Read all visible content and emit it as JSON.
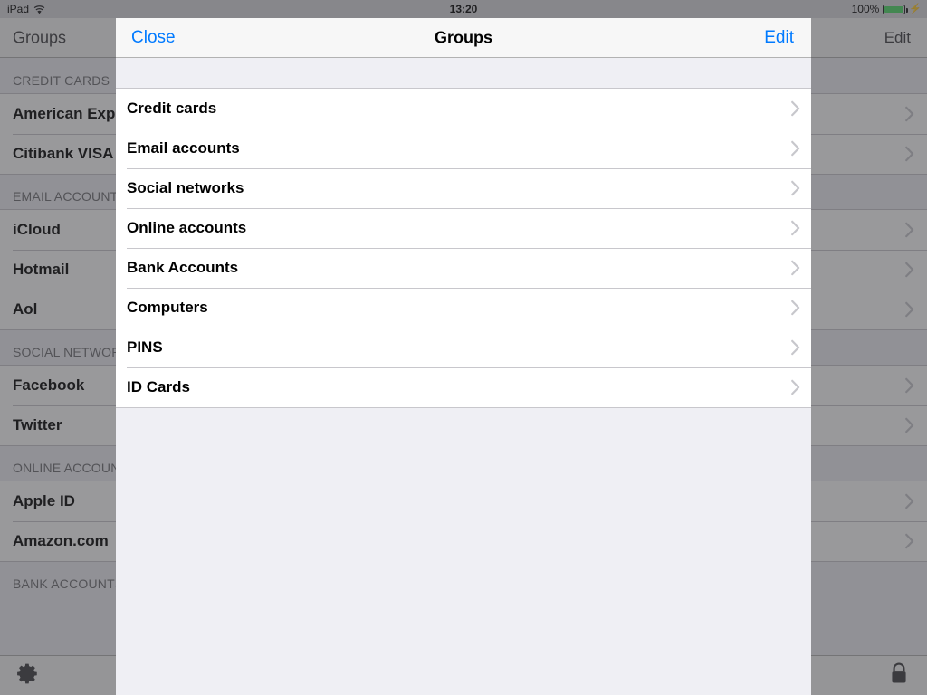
{
  "status_bar": {
    "device": "iPad",
    "wifi_icon": "wifi-icon",
    "time": "13:20",
    "battery_percent": "100%",
    "battery_icon": "battery-icon",
    "charging_icon": "lightning-bolt-icon"
  },
  "background": {
    "nav": {
      "title": "Groups",
      "edit_label": "Edit"
    },
    "sections": [
      {
        "header": "CREDIT CARDS",
        "rows": [
          "American Express",
          "Citibank VISA"
        ]
      },
      {
        "header": "EMAIL ACCOUNTS",
        "rows": [
          "iCloud",
          "Hotmail",
          "Aol"
        ]
      },
      {
        "header": "SOCIAL NETWORKS",
        "rows": [
          "Facebook",
          "Twitter"
        ]
      },
      {
        "header": "ONLINE ACCOUNTS",
        "rows": [
          "Apple ID",
          "Amazon.com"
        ]
      },
      {
        "header": "BANK ACCOUNTS",
        "rows": []
      }
    ],
    "toolbar": {
      "settings_icon": "gear-icon",
      "lock_icon": "lock-icon"
    }
  },
  "modal": {
    "close_label": "Close",
    "title": "Groups",
    "edit_label": "Edit",
    "rows": [
      {
        "label": "Credit cards",
        "accessory": "chevron-right-icon"
      },
      {
        "label": "Email accounts",
        "accessory": "chevron-right-icon"
      },
      {
        "label": "Social networks",
        "accessory": "chevron-right-icon"
      },
      {
        "label": "Online accounts",
        "accessory": "chevron-right-icon"
      },
      {
        "label": "Bank Accounts",
        "accessory": "chevron-right-icon"
      },
      {
        "label": "Computers",
        "accessory": "chevron-right-icon"
      },
      {
        "label": "PINS",
        "accessory": "chevron-right-icon"
      },
      {
        "label": "ID Cards",
        "accessory": "chevron-right-icon"
      }
    ]
  },
  "colors": {
    "accent_blue": "#007AFF",
    "battery_green": "#4CD964",
    "list_background": "#EFEFF4",
    "separator": "#C8C7CC",
    "chevron": "#C7C7CC"
  }
}
